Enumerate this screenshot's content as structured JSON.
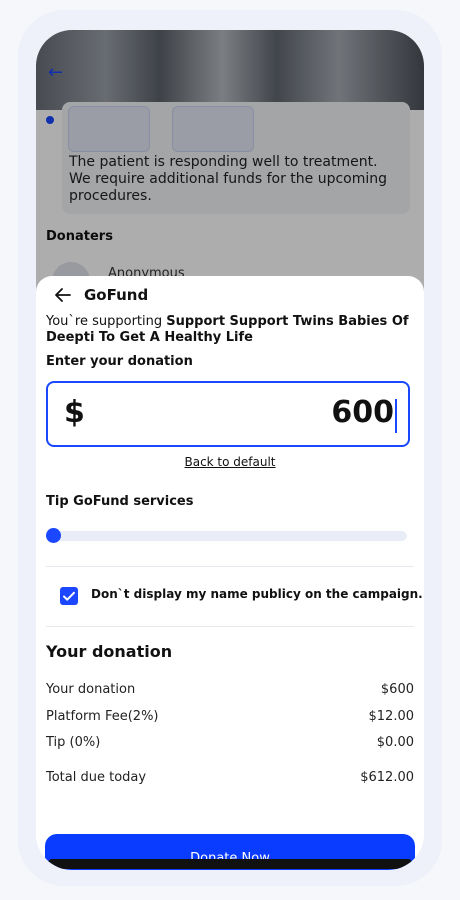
{
  "background": {
    "update_text": "The patient is responding well to treatment. We require additional funds for the upcoming procedures.",
    "donaters_title": "Donaters",
    "donor_name": "Anonymous"
  },
  "sheet": {
    "title": "GoFund",
    "support_prefix": "You`re supporting ",
    "campaign_name": "Support Support Twins Babies Of Deepti To Get A Healthy Life",
    "enter_label": "Enter your donation",
    "currency_symbol": "$",
    "amount": "600",
    "back_to_default": "Back to default",
    "tip_label": "Tip GoFund services",
    "tip_fraction": 0,
    "anonymous_checked": true,
    "anonymous_label": "Don`t display my name publicy on the campaign.",
    "summary_title": "Your donation",
    "summary": [
      {
        "label": "Your donation",
        "value": "$600"
      },
      {
        "label": "Platform Fee(2%)",
        "value": "$12.00"
      },
      {
        "label": "Tip (0%)",
        "value": "$0.00"
      }
    ],
    "total_label": "Total due today",
    "total_value": "$612.00",
    "donate_button": "Donate Now"
  },
  "colors": {
    "accent": "#1a47ff",
    "button": "#0a3cff"
  }
}
